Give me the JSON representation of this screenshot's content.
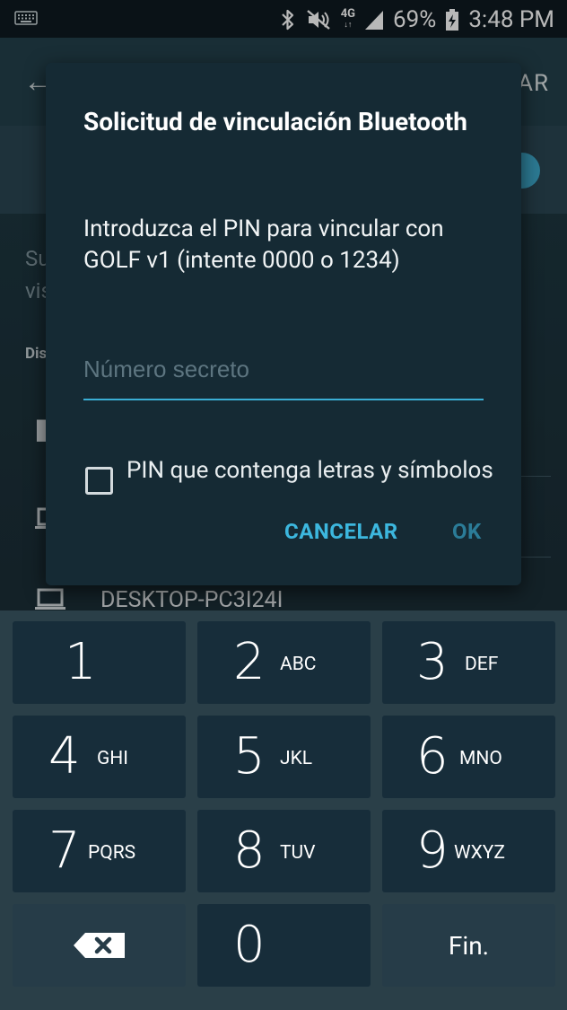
{
  "status_bar": {
    "network_top": "4G",
    "network_bottom": "↓↑",
    "battery": "69%",
    "time": "3:48 PM"
  },
  "background": {
    "scan_fragment": "AR",
    "description_fragment": "Su",
    "description_fragment2": "vis",
    "section_fragment": "Dis",
    "device_name": "DESKTOP-PC3I24I"
  },
  "dialog": {
    "title": "Solicitud de vinculación Bluetooth",
    "message": "Introduzca el PIN para vincular con GOLF v1 (intente 0000 o 1234)",
    "pin_placeholder": "Número secreto",
    "pin_value": "",
    "checkbox_label": "PIN que contenga letras y símbolos",
    "checkbox_checked": false,
    "cancel_label": "CANCELAR",
    "ok_label": "OK"
  },
  "keypad": {
    "keys": [
      {
        "num": "1",
        "letters": ""
      },
      {
        "num": "2",
        "letters": "ABC"
      },
      {
        "num": "3",
        "letters": "DEF"
      },
      {
        "num": "4",
        "letters": "GHI"
      },
      {
        "num": "5",
        "letters": "JKL"
      },
      {
        "num": "6",
        "letters": "MNO"
      },
      {
        "num": "7",
        "letters": "PQRS"
      },
      {
        "num": "8",
        "letters": "TUV"
      },
      {
        "num": "9",
        "letters": "WXYZ"
      },
      {
        "num": "0",
        "letters": ""
      }
    ],
    "done_label": "Fin."
  },
  "colors": {
    "accent": "#3cb7de",
    "dialog_bg": "#152a34",
    "key_bg": "#172d3a"
  }
}
